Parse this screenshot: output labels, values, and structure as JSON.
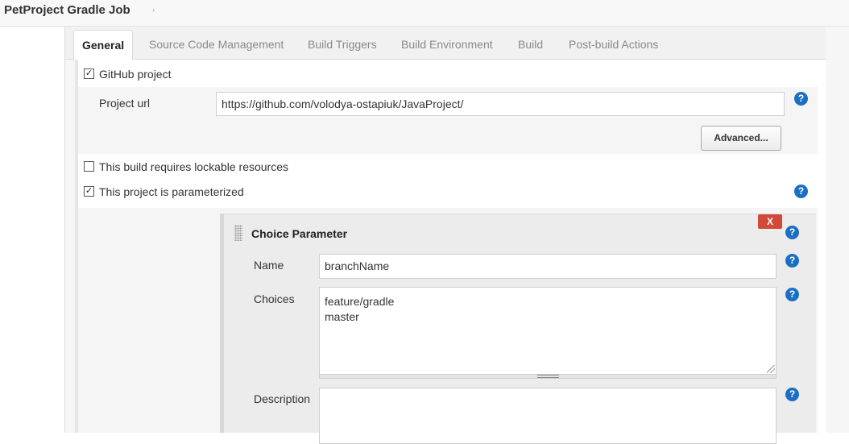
{
  "breadcrumb": {
    "job_name": "PetProject Gradle Job",
    "arrow": "›"
  },
  "tabs": [
    {
      "label": "General"
    },
    {
      "label": "Source Code Management"
    },
    {
      "label": "Build Triggers"
    },
    {
      "label": "Build Environment"
    },
    {
      "label": "Build"
    },
    {
      "label": "Post-build Actions"
    }
  ],
  "general": {
    "github_project": {
      "label": "GitHub project",
      "checked": "✓"
    },
    "project_url": {
      "label": "Project url",
      "value": "https://github.com/volodya-ostapiuk/JavaProject/"
    },
    "advanced_button": "Advanced...",
    "lockable": {
      "label": "This build requires lockable resources",
      "checked": ""
    },
    "parameterized": {
      "label": "This project is parameterized",
      "checked": "✓"
    }
  },
  "choice_parameter": {
    "title": "Choice Parameter",
    "delete_label": "X",
    "name": {
      "label": "Name",
      "value": "branchName"
    },
    "choices": {
      "label": "Choices",
      "values": [
        "feature/gradle",
        "master"
      ]
    },
    "description": {
      "label": "Description",
      "value": ""
    }
  },
  "help_glyph": "?",
  "icons": {
    "help": "question-circle-icon",
    "delete": "close-icon",
    "drag": "drag-handle-icon",
    "checkbox": "checkbox-icon"
  },
  "colors": {
    "help_blue": "#1b6fc2",
    "delete_red": "#d24939",
    "tab_bar": "#f1f1f1"
  }
}
